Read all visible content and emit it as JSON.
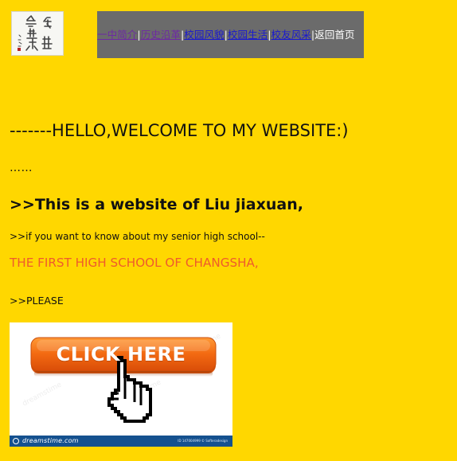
{
  "nav": {
    "items": [
      {
        "label": "一中简介"
      },
      {
        "label": "历史沿革"
      },
      {
        "label": "校园风貌"
      },
      {
        "label": "校园生活"
      },
      {
        "label": "校友风采"
      }
    ],
    "separator": "|",
    "home_label": "返回首页"
  },
  "content": {
    "welcome": "-------HELLO,WELCOME TO MY WEBSITE:)",
    "dots": "……",
    "intro": ">>This is a website of Liu jiaxuan,",
    "know": ">>if you want to know about my senior high school--",
    "school": "THE FIRST HIGH SCHOOL OF CHANGSHA,",
    "please": ">>PLEASE"
  },
  "click_image": {
    "button_label": "CLICK HERE",
    "watermark": "dreamstime.com",
    "image_id": "ID 147004999 © Softeradesign"
  },
  "colors": {
    "page_background": "#FFD700",
    "nav_background": "#6B6B6B",
    "school_text": "#EF5B2C",
    "button_orange": "#F36A12"
  },
  "icons": {
    "logo": "school-calligraphy-logo",
    "cursor": "hand-pointer-icon",
    "watermark_mark": "dreamstime-logo-icon"
  }
}
